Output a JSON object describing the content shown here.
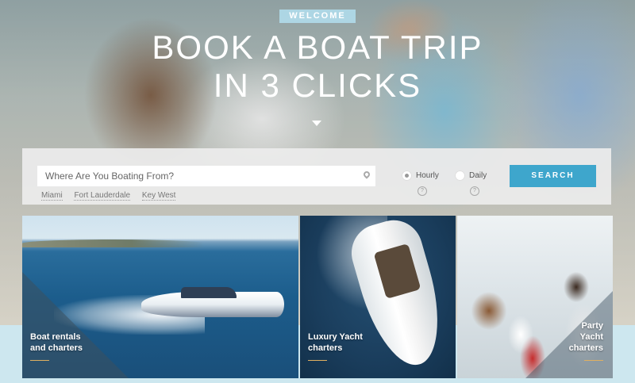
{
  "hero": {
    "welcome": "WELCOME",
    "title_line1": "BOOK A BOAT TRIP",
    "title_line2": "IN 3 CLICKS"
  },
  "search": {
    "placeholder": "Where Are You Boating From?",
    "quick_links": [
      "Miami",
      "Fort Lauderdale",
      "Key West"
    ],
    "options": [
      {
        "label": "Hourly",
        "selected": true
      },
      {
        "label": "Daily",
        "selected": false
      }
    ],
    "help_glyph": "?",
    "button_label": "SEARCH"
  },
  "cards": [
    {
      "line1": "Boat rentals",
      "line2": "and charters"
    },
    {
      "line1": "Luxury Yacht",
      "line2": "charters"
    },
    {
      "line1": "Party",
      "line2": "Yacht",
      "line3": "charters"
    }
  ],
  "colors": {
    "accent": "#3ea6cc",
    "welcome_bg": "#b0dceb",
    "underline": "#e0b060"
  }
}
